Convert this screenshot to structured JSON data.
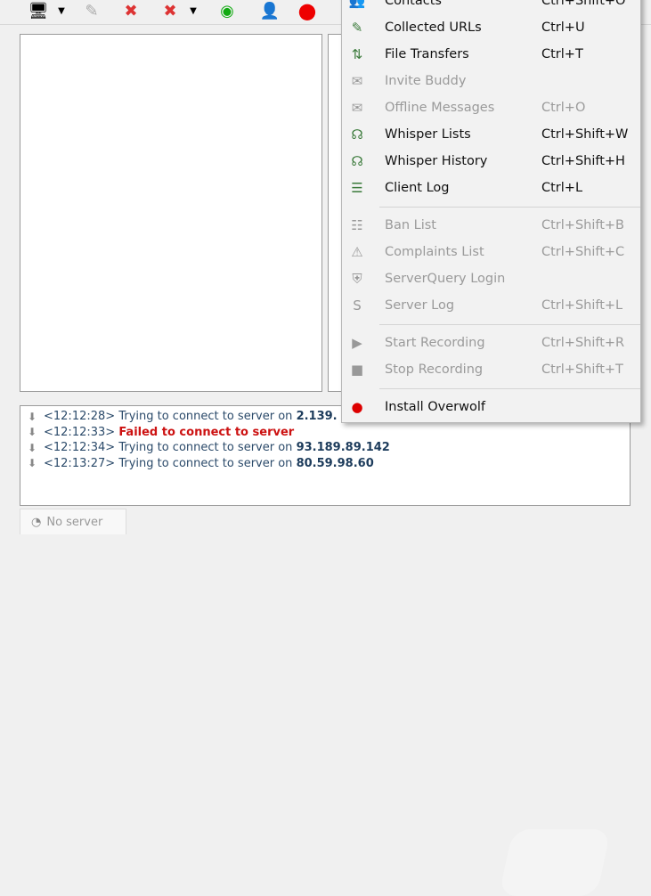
{
  "toolbar": {
    "icons": [
      "connect-icon",
      "bookmark-icon",
      "disconnect-icon",
      "disconnect-all-icon",
      "away-eye-icon",
      "identity-icon",
      "overwolf-icon"
    ]
  },
  "log": {
    "lines": [
      {
        "time": "<12:12:28>",
        "text": "Trying to connect to server on",
        "ip": "2.139."
      },
      {
        "time": "<12:12:33>",
        "error": "Failed to connect to server"
      },
      {
        "time": "<12:12:34>",
        "text": "Trying to connect to server on",
        "ip": "93.189.89.142"
      },
      {
        "time": "<12:13:27>",
        "text": "Trying to connect to server on",
        "ip": "80.59.98.60"
      }
    ]
  },
  "tab": {
    "label": "No server"
  },
  "menu": {
    "items": [
      {
        "label": "Contacts",
        "shortcut": "Ctrl+Shift+O",
        "enabled": true
      },
      {
        "label": "Collected URLs",
        "shortcut": "Ctrl+U",
        "enabled": true
      },
      {
        "label": "File Transfers",
        "shortcut": "Ctrl+T",
        "enabled": true
      },
      {
        "label": "Invite Buddy",
        "shortcut": "",
        "enabled": false
      },
      {
        "label": "Offline Messages",
        "shortcut": "Ctrl+O",
        "enabled": false
      },
      {
        "label": "Whisper Lists",
        "shortcut": "Ctrl+Shift+W",
        "enabled": true
      },
      {
        "label": "Whisper History",
        "shortcut": "Ctrl+Shift+H",
        "enabled": true
      },
      {
        "label": "Client Log",
        "shortcut": "Ctrl+L",
        "enabled": true
      },
      {
        "label": "Ban List",
        "shortcut": "Ctrl+Shift+B",
        "enabled": false
      },
      {
        "label": "Complaints List",
        "shortcut": "Ctrl+Shift+C",
        "enabled": false
      },
      {
        "label": "ServerQuery Login",
        "shortcut": "",
        "enabled": false
      },
      {
        "label": "Server Log",
        "shortcut": "Ctrl+Shift+L",
        "enabled": false
      },
      {
        "label": "Start Recording",
        "shortcut": "Ctrl+Shift+R",
        "enabled": false
      },
      {
        "label": "Stop Recording",
        "shortcut": "Ctrl+Shift+T",
        "enabled": false
      },
      {
        "label": "Install Overwolf",
        "shortcut": "",
        "enabled": true
      }
    ]
  }
}
